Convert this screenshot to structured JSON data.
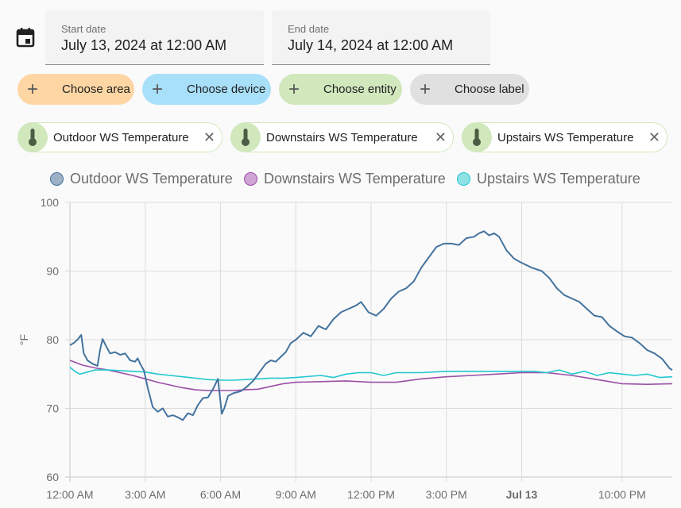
{
  "date_picker": {
    "icon": "calendar-icon",
    "start_label": "Start date",
    "start_value": "July 13, 2024 at 12:00 AM",
    "end_label": "End date",
    "end_value": "July 14, 2024 at 12:00 AM"
  },
  "target_pickers": [
    {
      "label": "Choose area",
      "icon": "plus-icon",
      "color": "#fed6a4"
    },
    {
      "label": "Choose device",
      "icon": "plus-icon",
      "color": "#a8dff9"
    },
    {
      "label": "Choose entity",
      "icon": "plus-icon",
      "color": "#d1e8bd"
    },
    {
      "label": "Choose label",
      "icon": "plus-icon",
      "color": "#e0e0e0"
    }
  ],
  "selected_entities": [
    {
      "label": "Outdoor WS Temperature",
      "icon": "thermometer-icon",
      "remove_icon": "close-icon"
    },
    {
      "label": "Downstairs WS Temperature",
      "icon": "thermometer-icon",
      "remove_icon": "close-icon"
    },
    {
      "label": "Upstairs WS Temperature",
      "icon": "thermometer-icon",
      "remove_icon": "close-icon"
    }
  ],
  "chart_data": {
    "type": "line",
    "title": "",
    "xlabel": "",
    "ylabel": "°F",
    "ylim": [
      60,
      100
    ],
    "xlim_hours": [
      0,
      24
    ],
    "y_ticks": [
      "60",
      "70",
      "80",
      "90",
      "100"
    ],
    "x_ticks": [
      {
        "hour": 0,
        "label": "12:00 AM",
        "bold": false
      },
      {
        "hour": 3,
        "label": "3:00 AM",
        "bold": false
      },
      {
        "hour": 6,
        "label": "6:00 AM",
        "bold": false
      },
      {
        "hour": 9,
        "label": "9:00 AM",
        "bold": false
      },
      {
        "hour": 12,
        "label": "12:00 PM",
        "bold": false
      },
      {
        "hour": 15,
        "label": "3:00 PM",
        "bold": false
      },
      {
        "hour": 18,
        "label": "Jul 13",
        "bold": true
      },
      {
        "hour": 22,
        "label": "10:00 PM",
        "bold": false
      }
    ],
    "grid": true,
    "legend_position": "top",
    "series": [
      {
        "name": "Outdoor WS Temperature",
        "color": "#44739e",
        "fill": "#9cb1c6",
        "x": [
          0,
          0.15,
          0.3,
          0.45,
          0.55,
          0.7,
          0.9,
          1.1,
          1.2,
          1.3,
          1.45,
          1.6,
          1.8,
          2.0,
          2.2,
          2.4,
          2.6,
          2.7,
          2.8,
          2.95,
          3.1,
          3.3,
          3.5,
          3.7,
          3.9,
          4.1,
          4.3,
          4.5,
          4.7,
          4.9,
          5.1,
          5.3,
          5.5,
          5.7,
          5.9,
          6.05,
          6.15,
          6.3,
          6.5,
          6.8,
          7.0,
          7.3,
          7.6,
          7.8,
          8.0,
          8.2,
          8.4,
          8.6,
          8.8,
          9.0,
          9.3,
          9.6,
          9.9,
          10.2,
          10.5,
          10.8,
          11.1,
          11.4,
          11.6,
          11.9,
          12.2,
          12.5,
          12.8,
          13.1,
          13.4,
          13.7,
          14.0,
          14.2,
          14.4,
          14.6,
          14.9,
          15.2,
          15.5,
          15.8,
          16.1,
          16.3,
          16.5,
          16.7,
          16.9,
          17.1,
          17.4,
          17.7,
          18.0,
          18.4,
          18.8,
          19.1,
          19.4,
          19.7,
          20.0,
          20.3,
          20.6,
          20.9,
          21.2,
          21.5,
          21.8,
          22.1,
          22.4,
          22.7,
          23.0,
          23.3,
          23.6,
          23.9,
          24
        ],
        "values": [
          79.2,
          79.5,
          80,
          80.7,
          78,
          77,
          76.5,
          76.2,
          78.5,
          80.1,
          79,
          78,
          78.2,
          77.8,
          78,
          77,
          76.8,
          77.3,
          76.5,
          75.5,
          73,
          70.2,
          69.5,
          70,
          68.8,
          69,
          68.7,
          68.3,
          69.3,
          69,
          70.5,
          71.5,
          71.6,
          72.8,
          74.3,
          69.2,
          70,
          71.8,
          72.2,
          72.5,
          73,
          74,
          75.5,
          76.5,
          77,
          76.8,
          77.5,
          78.2,
          79.5,
          80,
          81,
          80.5,
          82,
          81.5,
          83,
          84,
          84.5,
          85,
          85.5,
          84,
          83.5,
          84.5,
          86,
          87,
          87.5,
          88.5,
          90.5,
          91.5,
          92.5,
          93.5,
          94,
          94,
          93.8,
          94.8,
          95,
          95.5,
          95.8,
          95.2,
          95.5,
          95,
          93,
          91.8,
          91.2,
          90.5,
          90,
          89,
          87.5,
          86.5,
          86,
          85.5,
          84.5,
          83.5,
          83.3,
          82,
          81.2,
          80.5,
          80.3,
          79.5,
          78.5,
          78,
          77.2,
          75.8,
          75.6
        ]
      },
      {
        "name": "Downstairs WS Temperature",
        "color": "#9b4ea6",
        "fill": "#cfa5d4",
        "x": [
          0,
          0.5,
          1,
          1.5,
          2,
          2.5,
          3,
          3.5,
          4,
          4.5,
          5,
          5.5,
          6,
          6.5,
          7,
          7.5,
          8,
          8.5,
          9,
          10,
          11,
          12,
          13,
          14,
          15,
          16,
          17,
          18,
          19,
          20,
          21,
          22,
          23,
          24
        ],
        "values": [
          77,
          76.3,
          75.9,
          75.6,
          75.2,
          74.8,
          74.3,
          73.8,
          73.4,
          73,
          72.7,
          72.6,
          72.6,
          72.6,
          72.7,
          72.8,
          73.2,
          73.6,
          73.8,
          73.9,
          74,
          73.8,
          73.8,
          74.3,
          74.6,
          74.8,
          75,
          75.2,
          75.2,
          74.8,
          74.2,
          73.6,
          73.5,
          73.6
        ]
      },
      {
        "name": "Upstairs WS Temperature",
        "color": "#22c8cf",
        "fill": "#8ee2e6",
        "x": [
          0,
          0.2,
          0.4,
          0.7,
          1,
          1.5,
          2,
          2.5,
          3,
          3.5,
          4,
          4.5,
          5,
          5.5,
          6,
          6.5,
          7,
          7.5,
          8,
          8.5,
          9,
          10,
          10.5,
          11,
          11.5,
          12,
          12.5,
          13,
          14,
          15,
          16,
          17,
          18,
          18.5,
          19,
          19.5,
          20,
          20.5,
          21,
          21.5,
          22,
          22.5,
          23,
          23.5,
          24
        ],
        "values": [
          76,
          75.4,
          75,
          75.3,
          75.6,
          75.6,
          75.5,
          75.4,
          75.3,
          75,
          74.8,
          74.6,
          74.4,
          74.2,
          74.1,
          74.1,
          74.2,
          74.3,
          74.4,
          74.4,
          74.5,
          74.8,
          74.5,
          75,
          75.2,
          75.2,
          74.8,
          75.2,
          75.2,
          75.4,
          75.4,
          75.4,
          75.4,
          75.4,
          75.2,
          75.6,
          75,
          75.4,
          74.8,
          75.2,
          75,
          74.8,
          75,
          74.5,
          74.6
        ]
      }
    ]
  }
}
